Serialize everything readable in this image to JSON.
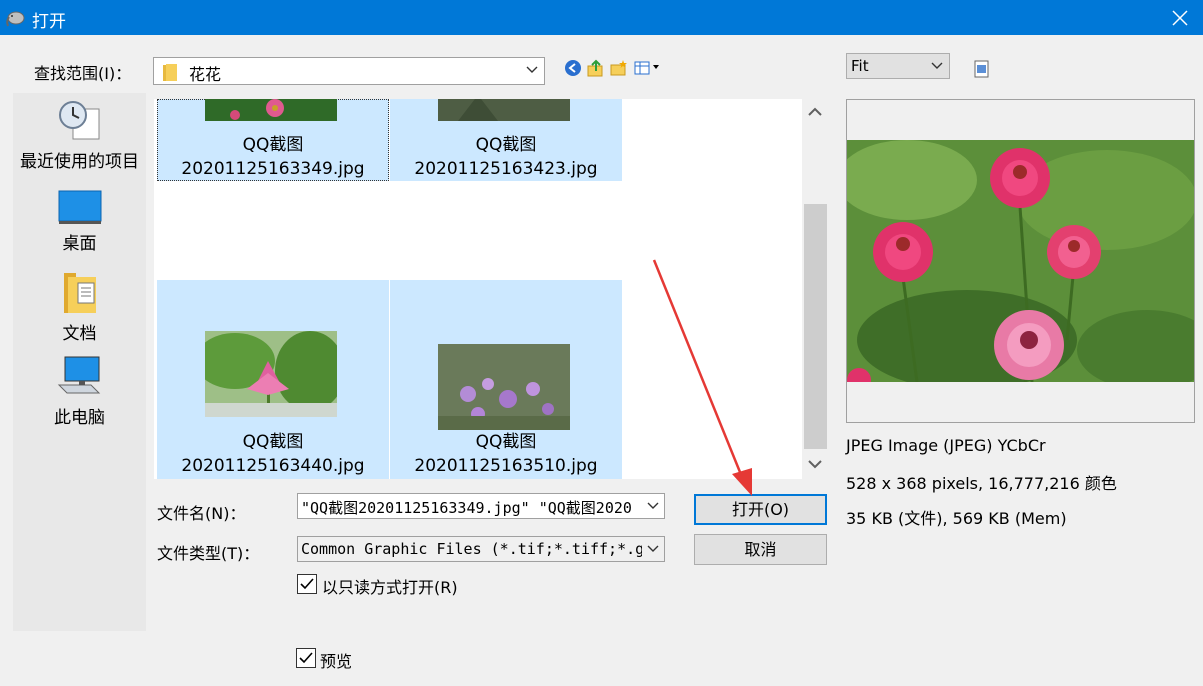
{
  "window": {
    "title": "打开"
  },
  "lookin": {
    "label": "查找范围(I)：",
    "value": "花花"
  },
  "places": [
    {
      "label": "最近使用的项目",
      "icon": "recent-items-icon"
    },
    {
      "label": "桌面",
      "icon": "desktop-icon"
    },
    {
      "label": "文档",
      "icon": "documents-icon"
    },
    {
      "label": "此电脑",
      "icon": "this-pc-icon"
    }
  ],
  "files": [
    {
      "name1": "QQ截图",
      "name2": "20201125163349.jpg"
    },
    {
      "name1": "QQ截图",
      "name2": "20201125163423.jpg"
    },
    {
      "name1": "QQ截图",
      "name2": "20201125163440.jpg"
    },
    {
      "name1": "QQ截图",
      "name2": "20201125163510.jpg"
    }
  ],
  "form": {
    "filename_label": "文件名(N)：",
    "filename_value": "\"QQ截图20201125163349.jpg\" \"QQ截图2020",
    "filetype_label": "文件类型(T)：",
    "filetype_value": "Common Graphic Files (*.tif;*.tiff;*.g",
    "open_label": "打开(O)",
    "cancel_label": "取消",
    "readonly_label": "以只读方式打开(R)",
    "preview_label": "预览"
  },
  "preview": {
    "zoom_value": "Fit",
    "type_info": "JPEG Image (JPEG) YCbCr",
    "dims_info": "528 x 368 pixels, 16,777,216 颜色",
    "size_info": "35 KB (文件), 569 KB (Mem)"
  },
  "colors": {
    "titlebar": "#0078d7",
    "selection": "#cce8ff",
    "annotation_arrow": "#e53935"
  }
}
